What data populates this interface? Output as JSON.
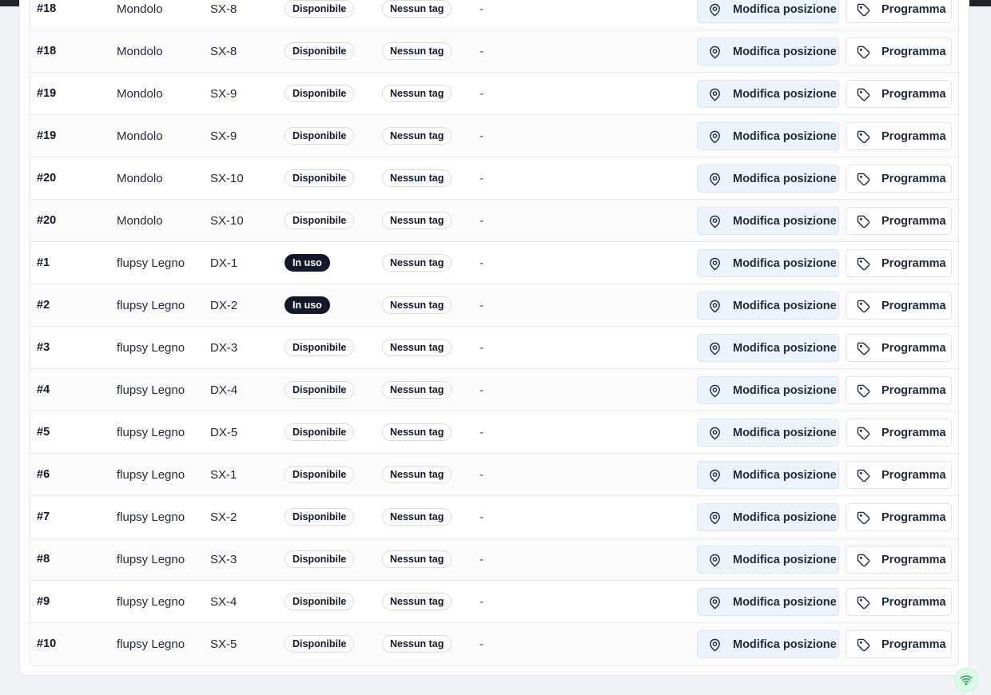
{
  "table": {
    "rows": [
      {
        "num": "#18",
        "flupsy": "Mondolo",
        "position": "SX-8",
        "state": "Disponibile",
        "state_type": "available",
        "tag": "Nessun tag",
        "note": "-"
      },
      {
        "num": "#18",
        "flupsy": "Mondolo",
        "position": "SX-8",
        "state": "Disponibile",
        "state_type": "available",
        "tag": "Nessun tag",
        "note": "-"
      },
      {
        "num": "#19",
        "flupsy": "Mondolo",
        "position": "SX-9",
        "state": "Disponibile",
        "state_type": "available",
        "tag": "Nessun tag",
        "note": "-"
      },
      {
        "num": "#19",
        "flupsy": "Mondolo",
        "position": "SX-9",
        "state": "Disponibile",
        "state_type": "available",
        "tag": "Nessun tag",
        "note": "-"
      },
      {
        "num": "#20",
        "flupsy": "Mondolo",
        "position": "SX-10",
        "state": "Disponibile",
        "state_type": "available",
        "tag": "Nessun tag",
        "note": "-"
      },
      {
        "num": "#20",
        "flupsy": "Mondolo",
        "position": "SX-10",
        "state": "Disponibile",
        "state_type": "available",
        "tag": "Nessun tag",
        "note": "-"
      },
      {
        "num": "#1",
        "flupsy": "flupsy Legno",
        "position": "DX-1",
        "state": "In uso",
        "state_type": "inuse",
        "tag": "Nessun tag",
        "note": "-"
      },
      {
        "num": "#2",
        "flupsy": "flupsy Legno",
        "position": "DX-2",
        "state": "In uso",
        "state_type": "inuse",
        "tag": "Nessun tag",
        "note": "-"
      },
      {
        "num": "#3",
        "flupsy": "flupsy Legno",
        "position": "DX-3",
        "state": "Disponibile",
        "state_type": "available",
        "tag": "Nessun tag",
        "note": "-"
      },
      {
        "num": "#4",
        "flupsy": "flupsy Legno",
        "position": "DX-4",
        "state": "Disponibile",
        "state_type": "available",
        "tag": "Nessun tag",
        "note": "-"
      },
      {
        "num": "#5",
        "flupsy": "flupsy Legno",
        "position": "DX-5",
        "state": "Disponibile",
        "state_type": "available",
        "tag": "Nessun tag",
        "note": "-"
      },
      {
        "num": "#6",
        "flupsy": "flupsy Legno",
        "position": "SX-1",
        "state": "Disponibile",
        "state_type": "available",
        "tag": "Nessun tag",
        "note": "-"
      },
      {
        "num": "#7",
        "flupsy": "flupsy Legno",
        "position": "SX-2",
        "state": "Disponibile",
        "state_type": "available",
        "tag": "Nessun tag",
        "note": "-"
      },
      {
        "num": "#8",
        "flupsy": "flupsy Legno",
        "position": "SX-3",
        "state": "Disponibile",
        "state_type": "available",
        "tag": "Nessun tag",
        "note": "-"
      },
      {
        "num": "#9",
        "flupsy": "flupsy Legno",
        "position": "SX-4",
        "state": "Disponibile",
        "state_type": "available",
        "tag": "Nessun tag",
        "note": "-"
      },
      {
        "num": "#10",
        "flupsy": "flupsy Legno",
        "position": "SX-5",
        "state": "Disponibile",
        "state_type": "available",
        "tag": "Nessun tag",
        "note": "-"
      }
    ],
    "actions": {
      "edit_position_label": "Modifica posizione",
      "edit_position_icon": "map-pin-icon",
      "schedule_label": "Programma",
      "schedule_icon": "tag-icon"
    }
  },
  "status_indicator": {
    "icon": "wifi-icon",
    "color": "#16a34a"
  },
  "colors": {
    "inuse_badge": "#14182a",
    "edit_button_bg": "#eef4fb"
  }
}
